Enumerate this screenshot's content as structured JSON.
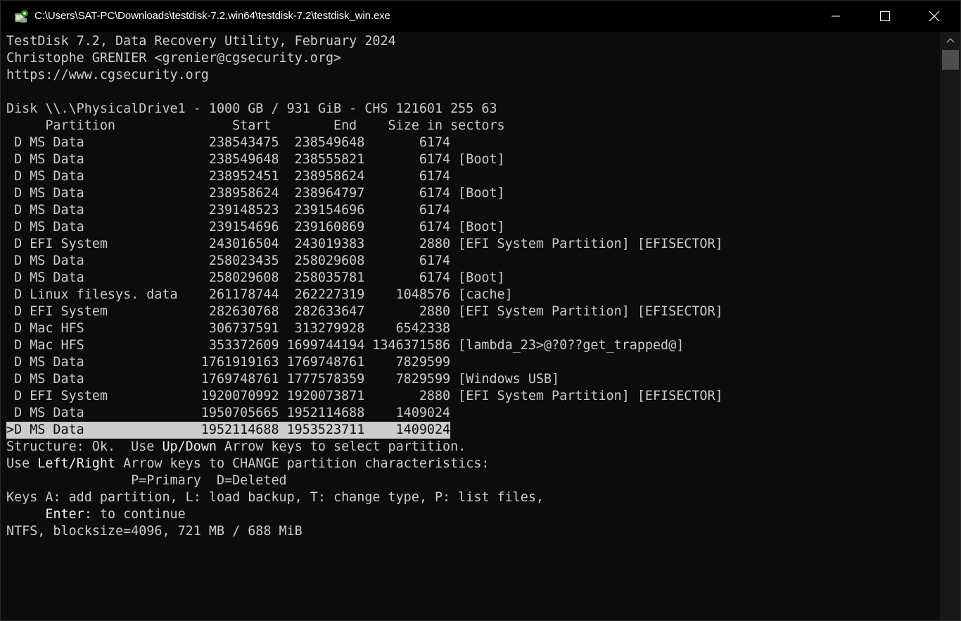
{
  "window": {
    "title": "C:\\Users\\SAT-PC\\Downloads\\testdisk-7.2.win64\\testdisk-7.2\\testdisk_win.exe",
    "icon": "testdisk-app-icon",
    "controls": {
      "minimize": "minimize-icon",
      "maximize": "maximize-icon",
      "close": "close-icon"
    }
  },
  "terminal": {
    "header": [
      "TestDisk 7.2, Data Recovery Utility, February 2024",
      "Christophe GRENIER <grenier@cgsecurity.org>",
      "https://www.cgsecurity.org"
    ],
    "disk_line": "Disk \\\\.\\PhysicalDrive1 - 1000 GB / 931 GiB - CHS 121601 255 63",
    "column_header": "     Partition               Start        End    Size in sectors",
    "partitions": [
      " D MS Data                238543475  238549648       6174",
      " D MS Data                238549648  238555821       6174 [Boot]",
      " D MS Data                238952451  238958624       6174",
      " D MS Data                238958624  238964797       6174 [Boot]",
      " D MS Data                239148523  239154696       6174",
      " D MS Data                239154696  239160869       6174 [Boot]",
      " D EFI System             243016504  243019383       2880 [EFI System Partition] [EFISECTOR]",
      " D MS Data                258023435  258029608       6174",
      " D MS Data                258029608  258035781       6174 [Boot]",
      " D Linux filesys. data    261178744  262227319    1048576 [cache]",
      " D EFI System             282630768  282633647       2880 [EFI System Partition] [EFISECTOR]",
      " D Mac HFS                306737591  313279928    6542338",
      " D Mac HFS                353372609 1699744194 1346371586 [lambda_23>@?0??get_trapped@]",
      " D MS Data               1761919163 1769748761    7829599",
      " D MS Data               1769748761 1777578359    7829599 [Windows USB]",
      " D EFI System            1920070992 1920073871       2880 [EFI System Partition] [EFISECTOR]",
      " D MS Data               1950705665 1952114688    1409024"
    ],
    "selected_partition": ">D MS Data               1952114688 1953523711    1409024",
    "status": {
      "structure_prefix": "Structure: Ok.  Use ",
      "up_down": "Up/Down",
      "structure_suffix": " Arrow keys to select partition.",
      "use_prefix": "Use ",
      "left_right": "Left/Right",
      "use_suffix": " Arrow keys to CHANGE partition characteristics:",
      "types": "                P=Primary  D=Deleted",
      "keys": "Keys A: add partition, L: load backup, T: change type, P: list files,",
      "enter_indent": "     ",
      "enter": "Enter",
      "enter_suffix": ": to continue",
      "fs_info": "NTFS, blocksize=4096, 721 MB / 688 MiB"
    }
  },
  "scrollbar": {
    "up_icon": "scroll-up-arrow-icon"
  }
}
